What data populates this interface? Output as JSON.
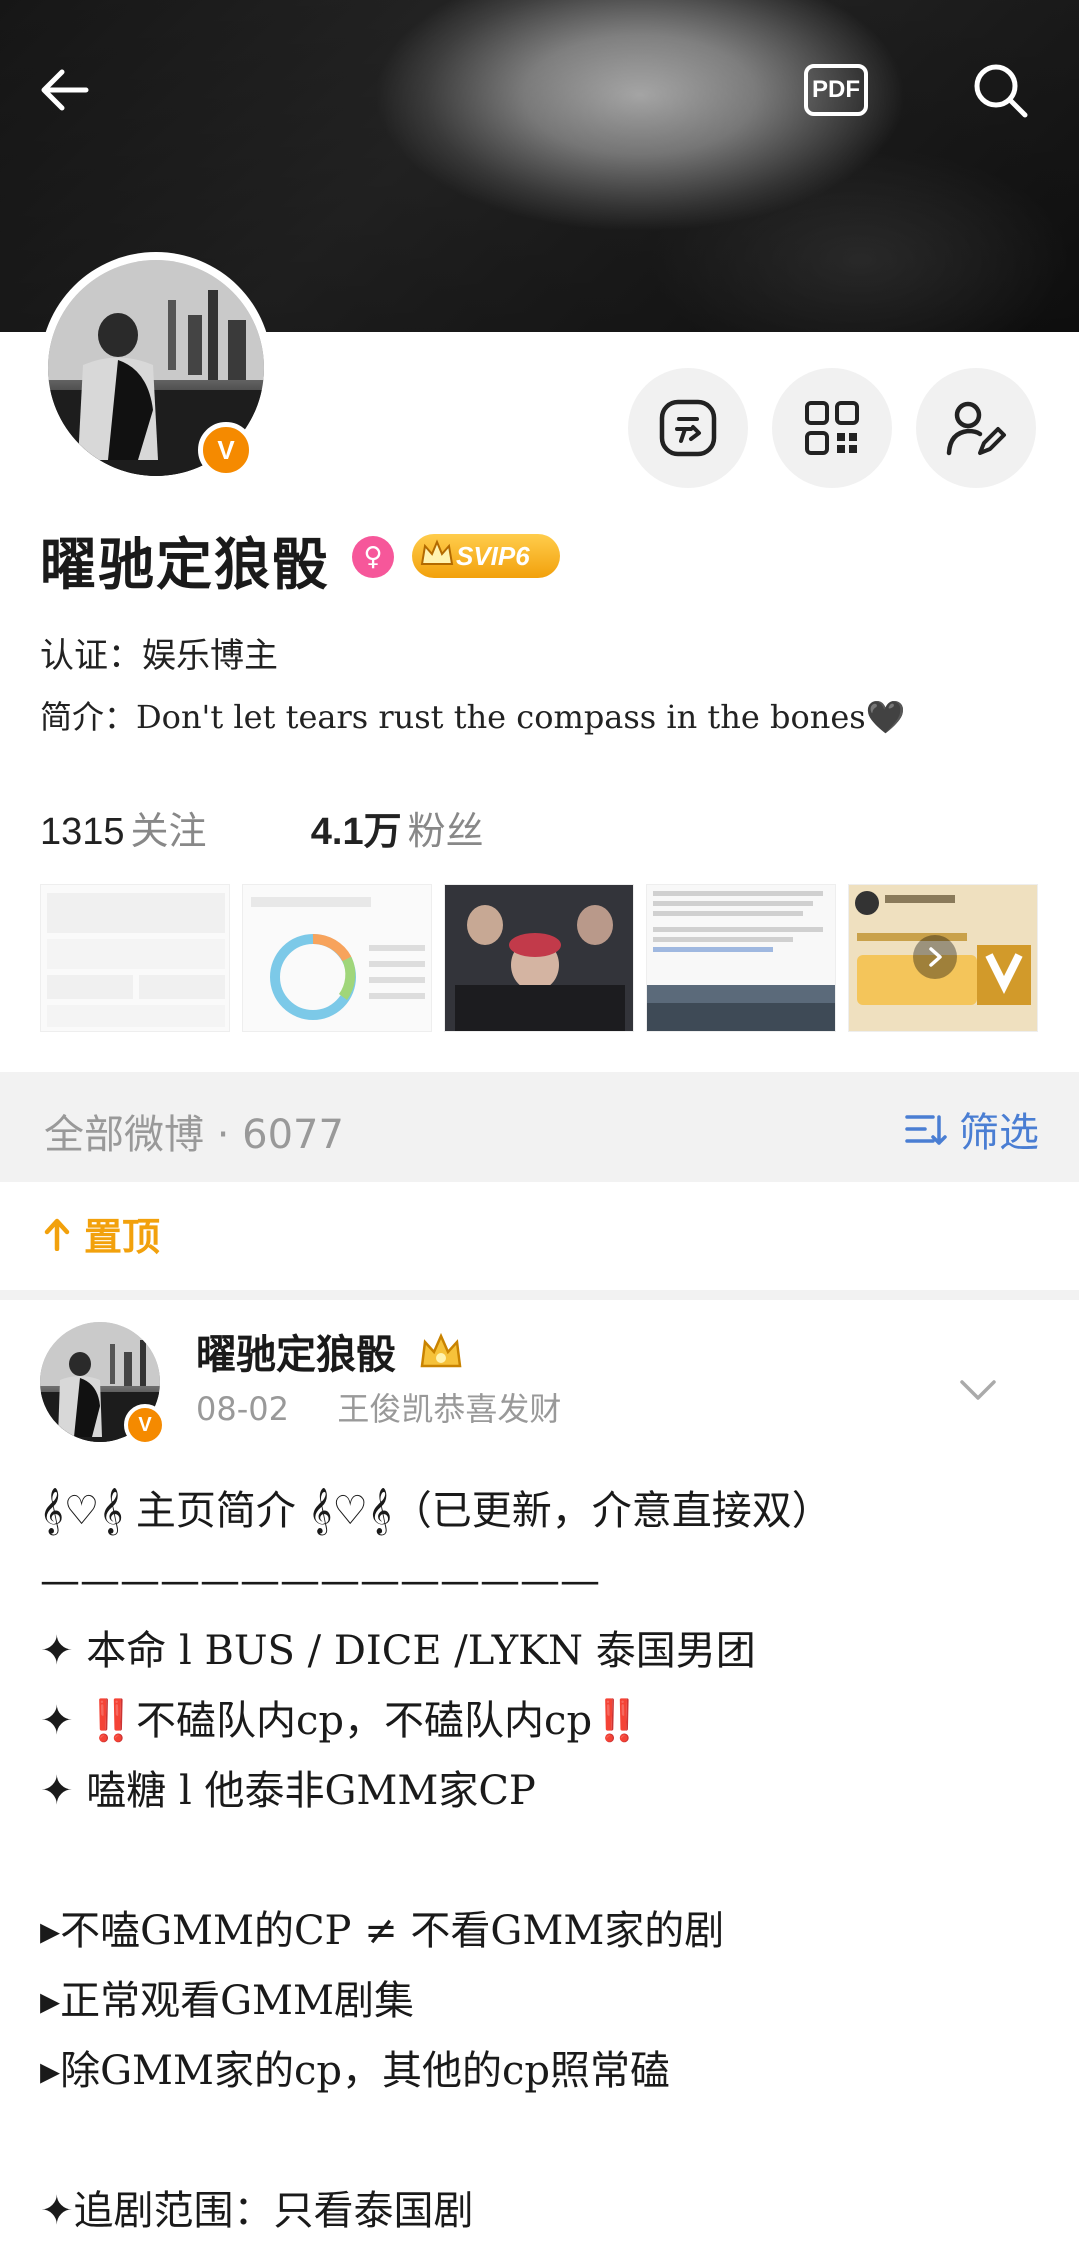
{
  "header": {
    "back_icon": "arrow-left-icon",
    "pdf_label": "PDF",
    "search_icon": "search-icon"
  },
  "profile": {
    "name": "曜驰定狼骰",
    "gender_icon": "female-icon",
    "svip_label": "SVIP6",
    "verified_badge": "V",
    "actions": [
      {
        "icon": "checkin-icon"
      },
      {
        "icon": "qrcode-icon"
      },
      {
        "icon": "edit-profile-icon"
      }
    ],
    "cert_label": "认证：",
    "cert_value": "娱乐博主",
    "bio_label": "简介：",
    "bio_value": "Don't let tears rust the compass in the bones🖤",
    "following_count": "1315",
    "following_label": "关注",
    "followers_count": "4.1万",
    "followers_label": "粉丝"
  },
  "colors": {
    "accent_orange": "#f58a00",
    "svip_gold": "#f2a10c",
    "link_blue": "#4a7ed3",
    "female_pink": "#f6579a"
  },
  "feed": {
    "all_posts_label": "全部微博 · 6077",
    "filter_label": "筛选",
    "pinned_label": "置顶"
  },
  "post": {
    "author": "曜驰定狼骰",
    "date": "08-02",
    "source": "王俊凯恭喜发财",
    "lines": [
      "𝄞♡𝄞 主页简介 𝄞♡𝄞（已更新，介意直接双）",
      "——————————————",
      "✦ 本命 l BUS / DICE /LYKN 泰国男团",
      "✦ ‼️不磕队内cp，不磕队内cp‼️",
      "✦ 嗑糖 l 他泰非GMM家CP",
      "",
      "▸不嗑GMM的CP ≠ 不看GMM家的剧",
      "▸正常观看GMM剧集",
      "▸除GMM家的cp，其他的cp照常磕",
      "",
      "✦追剧范围：只看泰国剧"
    ]
  }
}
